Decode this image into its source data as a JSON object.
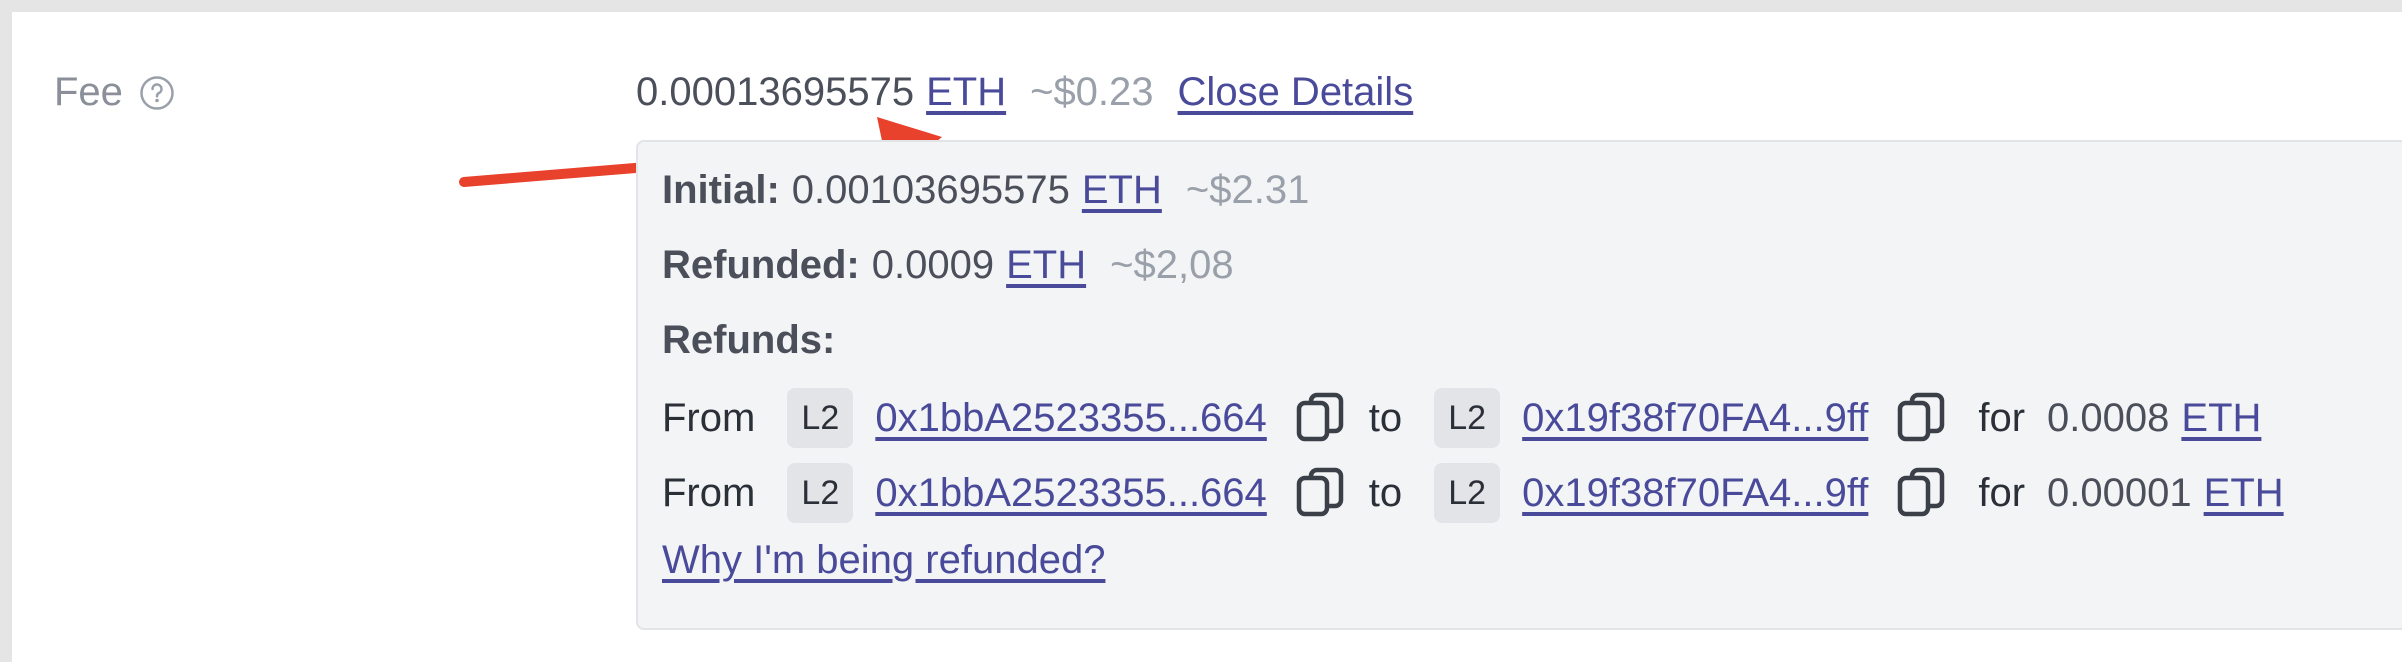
{
  "fee": {
    "label": "Fee",
    "amount": "0.00013695575",
    "currency": "ETH",
    "usd": "~$0.23",
    "close_details": "Close Details"
  },
  "details": {
    "initial_label": "Initial:",
    "initial_amount": "0.00103695575",
    "initial_currency": "ETH",
    "initial_usd": "~$2.31",
    "refunded_label": "Refunded:",
    "refunded_amount": "0.0009",
    "refunded_currency": "ETH",
    "refunded_usd": "~$2,08",
    "refunds_label": "Refunds:",
    "refunds": [
      {
        "from_label": "From",
        "from_chain": "L2",
        "from_address": "0x1bbA2523355...664",
        "to_label": "to",
        "to_chain": "L2",
        "to_address": "0x19f38f70FA4...9ff",
        "for_label": "for",
        "amount": "0.0008",
        "currency": "ETH"
      },
      {
        "from_label": "From",
        "from_chain": "L2",
        "from_address": "0x1bbA2523355...664",
        "to_label": "to",
        "to_chain": "L2",
        "to_address": "0x19f38f70FA4...9ff",
        "for_label": "for",
        "amount": "0.00001",
        "currency": "ETH"
      }
    ],
    "why_link": "Why I'm being refunded?"
  },
  "icons": {
    "help": "help-circle-icon",
    "copy": "copy-icon",
    "arrow": "annotation-arrow-icon"
  },
  "colors": {
    "link": "#4a4a9a",
    "arrow": "#e8412c",
    "muted": "#9aa0aa"
  }
}
